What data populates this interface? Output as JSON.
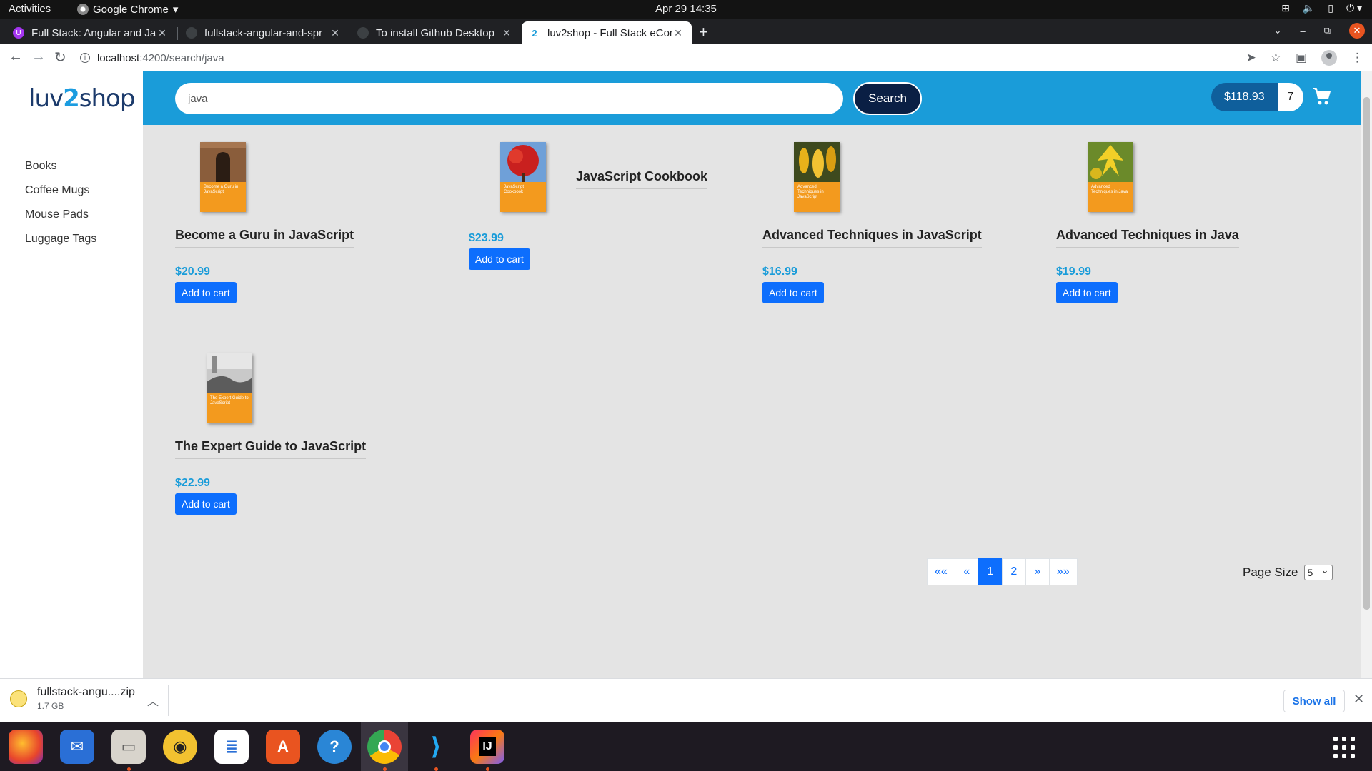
{
  "os_bar": {
    "activities": "Activities",
    "app_name": "Google Chrome",
    "clock": "Apr 29  14:35"
  },
  "tabs": [
    {
      "title": "Full Stack: Angular and Ja",
      "active": false
    },
    {
      "title": "fullstack-angular-and-spr",
      "active": false
    },
    {
      "title": "To install Github Desktop",
      "active": false
    },
    {
      "title": "luv2shop - Full Stack eCom",
      "active": true
    }
  ],
  "address": {
    "host": "localhost",
    "path": ":4200/search/java"
  },
  "site": {
    "logo": {
      "part1": "luv",
      "part2": "2",
      "part3": "shop"
    },
    "categories": [
      "Books",
      "Coffee Mugs",
      "Mouse Pads",
      "Luggage Tags"
    ],
    "search": {
      "value": "java",
      "button": "Search"
    },
    "cart": {
      "total": "$118.93",
      "quantity": "7"
    }
  },
  "products": [
    {
      "name": "Become a Guru in JavaScript",
      "price": "$20.99",
      "button": "Add to cart",
      "cover_text": "Become a Guru in JavaScript",
      "photo": "archway"
    },
    {
      "name": "JavaScript Cookbook",
      "price": "$23.99",
      "button": "Add to cart",
      "cover_text": "JavaScript Cookbook",
      "photo": "red-tree"
    },
    {
      "name": "Advanced Techniques in JavaScript",
      "price": "$16.99",
      "button": "Add to cart",
      "cover_text": "Advanced Techniques in JavaScript",
      "photo": "yellow-flowers"
    },
    {
      "name": "Advanced Techniques in Java",
      "price": "$19.99",
      "button": "Add to cart",
      "cover_text": "Advanced Techniques in Java",
      "photo": "yellow-leaves"
    },
    {
      "name": "The Expert Guide to JavaScript",
      "price": "$22.99",
      "button": "Add to cart",
      "cover_text": "The Expert Guide to JavaScript",
      "photo": "grey-landscape"
    }
  ],
  "pagination": {
    "first": "««",
    "prev": "«",
    "pages": [
      "1",
      "2"
    ],
    "current": "1",
    "next": "»",
    "last": "»»",
    "page_size_label": "Page Size",
    "page_size_value": "5"
  },
  "download": {
    "file": "fullstack-angu....zip",
    "size": "1.7 GB",
    "show_all": "Show all"
  },
  "colors": {
    "header": "#1a9cd9",
    "search_button": "#0a1f44",
    "cart_total": "#0f5f9c",
    "add_button": "#0d6efd",
    "price": "#1a9cd9"
  }
}
